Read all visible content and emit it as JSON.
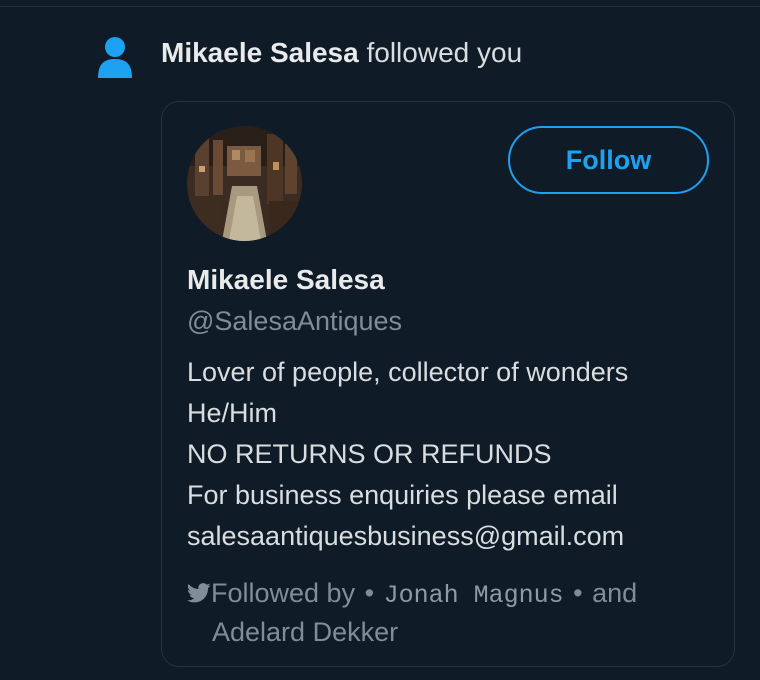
{
  "notification": {
    "actor_name": "Mikaele Salesa",
    "action_text": "followed you"
  },
  "card": {
    "follow_label": "Follow",
    "display_name": "Mikaele Salesa",
    "handle": "@SalesaAntiques",
    "bio_lines": [
      "Lover of people, collector of wonders",
      "He/Him",
      "NO RETURNS OR REFUNDS",
      "For business enquiries please email",
      "salesaantiquesbusiness@gmail.com"
    ],
    "followed_by": {
      "prefix": "Followed by",
      "separator": "•",
      "first_follower": "Jonah Magnus",
      "conjunction": "and",
      "second_follower": "Adelard Dekker"
    }
  },
  "colors": {
    "background": "#0f1c28",
    "accent": "#1da1f2",
    "muted_text": "#7f8d99",
    "primary_text": "#d9dde0"
  },
  "icons": {
    "notification_icon": "person-icon",
    "followed_by_icon": "bird-icon"
  }
}
